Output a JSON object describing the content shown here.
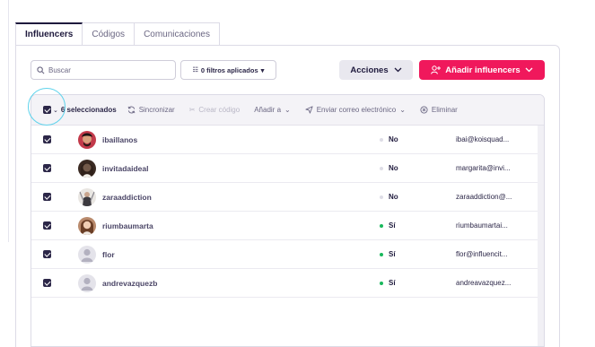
{
  "tabs": [
    {
      "label": "Influencers",
      "active": true
    },
    {
      "label": "Códigos",
      "active": false
    },
    {
      "label": "Comunicaciones",
      "active": false
    }
  ],
  "toolbar": {
    "search_placeholder": "Buscar",
    "filters_label": "0 filtros aplicados",
    "actions_label": "Acciones",
    "add_label": "Añadir influencers"
  },
  "bulk": {
    "selected_label": "6 seleccionados",
    "sync_label": "Sincronizar",
    "create_code_label": "Crear código",
    "add_to_label": "Añadir a",
    "send_email_label": "Enviar correo electrónico",
    "delete_label": "Eliminar"
  },
  "colors": {
    "accent": "#f0185c",
    "status_yes": "#19b85c",
    "status_no": "#dedde6",
    "checkbox": "#2c2748",
    "highlight": "#5fd3ec"
  },
  "rows": [
    {
      "handle": "ibaillanos",
      "status": "No",
      "email": "ibai@koisquad...",
      "avatar": "photo"
    },
    {
      "handle": "invitadaideal",
      "status": "No",
      "email": "margarita@invi...",
      "avatar": "photo"
    },
    {
      "handle": "zaraaddiction",
      "status": "No",
      "email": "zaraaddiction@...",
      "avatar": "photo"
    },
    {
      "handle": "riumbaumarta",
      "status": "Sí",
      "email": "riumbaumartai...",
      "avatar": "photo"
    },
    {
      "handle": "flor",
      "status": "Sí",
      "email": "flor@influencit...",
      "avatar": "placeholder"
    },
    {
      "handle": "andrevazquezb",
      "status": "Sí",
      "email": "andreavazquez...",
      "avatar": "placeholder"
    }
  ]
}
